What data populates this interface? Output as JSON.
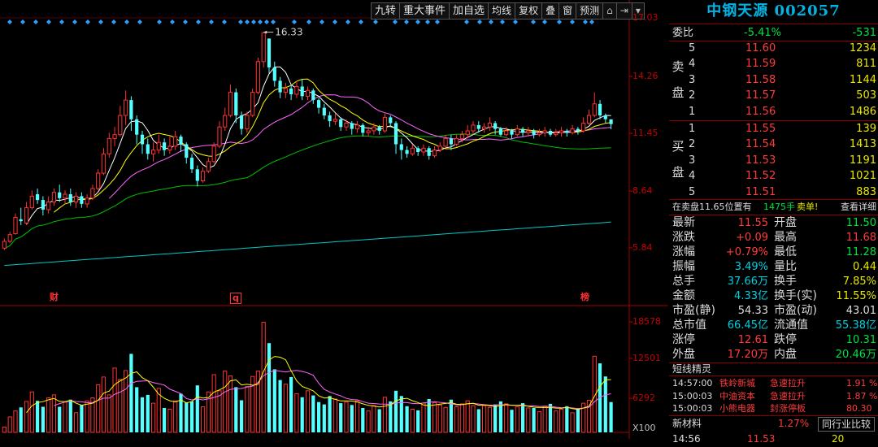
{
  "toolbar": [
    {
      "name": "jiuzhuan-button",
      "label": "九转"
    },
    {
      "name": "major-events-button",
      "label": "重大事件"
    },
    {
      "name": "add-watchlist-button",
      "label": "加自选"
    },
    {
      "name": "ma-line-button",
      "label": "均线"
    },
    {
      "name": "adjust-button",
      "label": "复权"
    },
    {
      "name": "overlay-button",
      "label": "叠"
    },
    {
      "name": "window-button",
      "label": "窗"
    },
    {
      "name": "forecast-button",
      "label": "预测"
    }
  ],
  "toolbar_icons": {
    "lock": "lock-icon",
    "skip": "skip-end-icon",
    "menu": "dropdown-icon"
  },
  "chart_data": {
    "type": "candlestick",
    "price_axis": {
      "ticks": [
        "17.03",
        "14.26",
        "11.45",
        "8.64",
        "5.84"
      ],
      "ylim": [
        3.0,
        17.03
      ]
    },
    "high_annotation": "16.33",
    "markers": [
      {
        "label": "财",
        "color": "#ff3030"
      },
      {
        "label": "q",
        "color": "#ff3030"
      },
      {
        "label": "榜",
        "color": "#ff3030"
      }
    ],
    "volume_axis": {
      "ticks": [
        "18578",
        "12501",
        "6292"
      ],
      "unit": "X100",
      "ylim": [
        0,
        18578
      ]
    },
    "colors": {
      "up": "#ff3232",
      "down": "#54ffff",
      "ma5": "#ffffff",
      "ma10": "#ffff00",
      "ma20": "#ff66ff",
      "ma60": "#00c000",
      "ma250": "#00c8c8",
      "vol_ma5": "#ffff00",
      "vol_ma10": "#ff66ff"
    },
    "candles": [
      [
        5.1,
        5.45,
        5.6,
        5.0
      ],
      [
        5.45,
        5.8,
        5.95,
        5.35
      ],
      [
        5.85,
        6.7,
        6.9,
        5.8
      ],
      [
        6.6,
        6.5,
        7.2,
        6.3
      ],
      [
        6.4,
        7.2,
        7.5,
        6.3
      ],
      [
        7.2,
        7.8,
        8.1,
        7.1
      ],
      [
        7.9,
        7.6,
        8.2,
        7.4
      ],
      [
        7.6,
        7.1,
        7.8,
        6.8
      ],
      [
        7.1,
        7.5,
        7.8,
        6.9
      ],
      [
        7.5,
        8.0,
        8.2,
        7.3
      ],
      [
        8.0,
        7.7,
        8.4,
        7.5
      ],
      [
        7.7,
        7.9,
        8.1,
        7.4
      ],
      [
        7.9,
        7.5,
        8.2,
        7.3
      ],
      [
        7.5,
        7.8,
        8.0,
        7.2
      ],
      [
        7.8,
        7.4,
        8.0,
        7.2
      ],
      [
        7.4,
        7.7,
        7.9,
        7.2
      ],
      [
        7.7,
        8.2,
        8.4,
        7.6
      ],
      [
        8.2,
        9.0,
        9.2,
        8.1
      ],
      [
        9.0,
        10.0,
        10.3,
        8.9
      ],
      [
        10.0,
        10.8,
        11.1,
        9.8
      ],
      [
        10.8,
        11.0,
        11.4,
        10.4
      ],
      [
        11.0,
        12.0,
        12.5,
        10.9
      ],
      [
        12.0,
        12.8,
        13.3,
        11.5
      ],
      [
        12.8,
        11.8,
        13.0,
        11.2
      ],
      [
        11.8,
        11.0,
        12.0,
        10.5
      ],
      [
        11.0,
        10.5,
        11.2,
        10.0
      ],
      [
        10.5,
        10.0,
        10.8,
        9.7
      ],
      [
        10.0,
        10.2,
        10.6,
        9.6
      ],
      [
        10.2,
        10.6,
        11.0,
        10.0
      ],
      [
        10.6,
        10.2,
        10.8,
        9.9
      ],
      [
        10.2,
        10.4,
        10.9,
        10.0
      ],
      [
        10.4,
        10.9,
        11.2,
        10.2
      ],
      [
        10.9,
        10.5,
        11.0,
        10.1
      ],
      [
        10.5,
        9.8,
        10.6,
        9.5
      ],
      [
        9.8,
        9.2,
        10.0,
        9.0
      ],
      [
        9.2,
        8.6,
        9.4,
        8.3
      ],
      [
        8.6,
        9.1,
        9.3,
        8.5
      ],
      [
        9.1,
        9.6,
        9.8,
        9.0
      ],
      [
        9.6,
        10.4,
        10.6,
        9.5
      ],
      [
        10.4,
        11.4,
        11.7,
        10.3
      ],
      [
        11.4,
        12.0,
        12.4,
        11.2
      ],
      [
        12.0,
        13.2,
        13.6,
        11.9
      ],
      [
        13.2,
        12.0,
        13.4,
        11.6
      ],
      [
        12.0,
        11.3,
        12.2,
        11.0
      ],
      [
        11.3,
        12.0,
        12.2,
        11.1
      ],
      [
        12.0,
        13.2,
        13.4,
        11.9
      ],
      [
        13.2,
        14.8,
        15.0,
        13.1
      ],
      [
        14.8,
        16.3,
        16.33,
        14.5
      ],
      [
        16.0,
        14.5,
        16.0,
        14.2
      ],
      [
        14.5,
        13.8,
        14.8,
        13.5
      ],
      [
        13.8,
        13.2,
        14.0,
        12.9
      ],
      [
        13.2,
        13.4,
        13.7,
        12.9
      ],
      [
        13.4,
        13.1,
        13.6,
        12.8
      ],
      [
        13.1,
        13.5,
        13.8,
        12.9
      ],
      [
        13.5,
        13.0,
        13.9,
        12.8
      ],
      [
        13.0,
        13.3,
        13.5,
        12.8
      ],
      [
        13.3,
        12.8,
        13.4,
        12.6
      ],
      [
        12.8,
        12.4,
        12.9,
        12.1
      ],
      [
        12.4,
        12.0,
        12.6,
        11.8
      ],
      [
        12.0,
        11.7,
        12.2,
        11.4
      ],
      [
        11.7,
        11.8,
        12.1,
        11.5
      ],
      [
        11.8,
        11.4,
        11.9,
        11.2
      ],
      [
        11.4,
        11.6,
        11.8,
        11.2
      ],
      [
        11.6,
        11.3,
        11.7,
        11.0
      ],
      [
        11.3,
        11.5,
        11.7,
        11.1
      ],
      [
        11.5,
        11.1,
        11.6,
        10.9
      ],
      [
        11.1,
        11.2,
        11.4,
        10.9
      ],
      [
        11.2,
        11.4,
        11.6,
        11.0
      ],
      [
        11.4,
        11.2,
        11.5,
        11.0
      ],
      [
        11.2,
        11.9,
        12.1,
        11.1
      ],
      [
        11.9,
        11.6,
        12.0,
        11.4
      ],
      [
        11.6,
        10.5,
        11.7,
        10.0
      ],
      [
        10.5,
        10.2,
        10.8,
        9.7
      ],
      [
        10.2,
        10.0,
        10.4,
        9.8
      ],
      [
        10.0,
        10.3,
        10.5,
        9.9
      ],
      [
        10.3,
        10.1,
        10.4,
        9.9
      ],
      [
        10.1,
        10.3,
        10.5,
        9.9
      ],
      [
        10.3,
        9.9,
        10.4,
        9.7
      ],
      [
        9.9,
        10.2,
        10.4,
        9.8
      ],
      [
        10.2,
        10.4,
        10.6,
        10.1
      ],
      [
        10.4,
        10.8,
        11.0,
        10.3
      ],
      [
        10.8,
        10.5,
        11.0,
        10.2
      ],
      [
        10.5,
        10.8,
        11.0,
        10.4
      ],
      [
        10.8,
        11.0,
        11.2,
        10.6
      ],
      [
        11.0,
        11.2,
        11.5,
        10.8
      ],
      [
        11.2,
        11.5,
        11.7,
        11.0
      ],
      [
        11.5,
        11.3,
        11.7,
        11.1
      ],
      [
        11.3,
        11.4,
        11.6,
        11.1
      ],
      [
        11.4,
        11.6,
        11.9,
        11.2
      ],
      [
        11.6,
        11.3,
        11.7,
        11.0
      ],
      [
        11.3,
        11.0,
        11.4,
        10.9
      ],
      [
        11.0,
        11.2,
        11.4,
        10.9
      ],
      [
        11.2,
        11.0,
        11.3,
        10.8
      ],
      [
        11.0,
        11.3,
        11.5,
        10.9
      ],
      [
        11.3,
        11.1,
        11.4,
        10.9
      ],
      [
        11.1,
        11.2,
        11.4,
        10.9
      ],
      [
        11.2,
        11.0,
        11.3,
        10.8
      ],
      [
        11.0,
        11.1,
        11.3,
        10.9
      ],
      [
        11.1,
        11.2,
        11.4,
        10.9
      ],
      [
        11.2,
        11.0,
        11.3,
        10.9
      ],
      [
        11.0,
        11.1,
        11.3,
        10.9
      ],
      [
        11.1,
        11.2,
        11.4,
        10.9
      ],
      [
        11.2,
        11.1,
        11.3,
        10.9
      ],
      [
        11.1,
        11.3,
        11.5,
        11.0
      ],
      [
        11.3,
        11.2,
        11.4,
        11.0
      ],
      [
        11.2,
        11.6,
        11.9,
        11.1
      ],
      [
        11.6,
        12.0,
        12.3,
        11.5
      ],
      [
        12.0,
        12.6,
        13.2,
        11.9
      ],
      [
        12.6,
        12.0,
        12.8,
        11.8
      ],
      [
        12.0,
        11.8,
        12.1,
        11.6
      ],
      [
        11.8,
        11.55,
        11.68,
        11.28
      ]
    ],
    "volumes": [
      900,
      2600,
      3600,
      4200,
      5200,
      6800,
      5300,
      4300,
      5800,
      6300,
      4300,
      5100,
      5500,
      3300,
      4600,
      5300,
      5800,
      8000,
      9300,
      6300,
      10800,
      8900,
      10400,
      13200,
      7600,
      5900,
      6300,
      4900,
      7400,
      4100,
      3900,
      5300,
      6500,
      5000,
      5200,
      7900,
      4300,
      6800,
      9700,
      7000,
      10300,
      9500,
      7600,
      5400,
      7700,
      9400,
      10300,
      18500,
      15000,
      10600,
      8800,
      8100,
      9300,
      6500,
      5900,
      7000,
      6200,
      5100,
      4700,
      6100,
      5600,
      4900,
      5100,
      4600,
      5300,
      4100,
      3600,
      4500,
      3900,
      5900,
      5200,
      7000,
      6100,
      4400,
      3900,
      3700,
      4900,
      5600,
      5000,
      4600,
      4200,
      5500,
      4300,
      4800,
      5300,
      4500,
      3900,
      4500,
      4200,
      4700,
      5200,
      4800,
      3800,
      4300,
      4900,
      4100,
      4100,
      3500,
      4400,
      4800,
      3600,
      3900,
      4400,
      3300,
      4000,
      4900,
      5400,
      12800,
      11600,
      9400,
      5100
    ]
  },
  "quote": {
    "title": "中钢天源 002057",
    "webi": {
      "label": "委比",
      "pct": "-5.41%",
      "diff": "-531"
    },
    "sell_side_label": [
      "卖",
      "盘"
    ],
    "buy_side_label": [
      "买",
      "盘"
    ],
    "sell": [
      {
        "lvl": "5",
        "price": "11.60",
        "vol": "1234"
      },
      {
        "lvl": "4",
        "price": "11.59",
        "vol": "811"
      },
      {
        "lvl": "3",
        "price": "11.58",
        "vol": "1144"
      },
      {
        "lvl": "2",
        "price": "11.57",
        "vol": "503"
      },
      {
        "lvl": "1",
        "price": "11.56",
        "vol": "1486"
      }
    ],
    "buy": [
      {
        "lvl": "1",
        "price": "11.55",
        "vol": "139"
      },
      {
        "lvl": "2",
        "price": "11.54",
        "vol": "1413"
      },
      {
        "lvl": "3",
        "price": "11.53",
        "vol": "1191"
      },
      {
        "lvl": "4",
        "price": "11.52",
        "vol": "1021"
      },
      {
        "lvl": "5",
        "price": "11.51",
        "vol": "883"
      }
    ],
    "alert": {
      "text": "在卖盘11.65位置有",
      "qty": "1475手",
      "kind": "卖单!",
      "link": "查看详细"
    },
    "stats": [
      {
        "l1": "最新",
        "v1": "11.55",
        "c1": "red",
        "l2": "开盘",
        "v2": "11.50",
        "c2": "green"
      },
      {
        "l1": "涨跌",
        "v1": "+0.09",
        "c1": "red",
        "l2": "最高",
        "v2": "11.68",
        "c2": "red"
      },
      {
        "l1": "涨幅",
        "v1": "+0.79%",
        "c1": "red",
        "l2": "最低",
        "v2": "11.28",
        "c2": "green"
      },
      {
        "l1": "振幅",
        "v1": "3.49%",
        "c1": "cyan",
        "l2": "量比",
        "v2": "0.44",
        "c2": "yellow"
      },
      {
        "l1": "总手",
        "v1": "37.66万",
        "c1": "cyan",
        "l2": "换手",
        "v2": "7.85%",
        "c2": "yellow"
      },
      {
        "l1": "金额",
        "v1": "4.33亿",
        "c1": "cyan",
        "l2": "换手(实)",
        "v2": "11.55%",
        "c2": "yellow"
      },
      {
        "l1": "市盈(静)",
        "v1": "54.33",
        "c1": "white",
        "l2": "市盈(动)",
        "v2": "43.01",
        "c2": "white"
      },
      {
        "l1": "总市值",
        "v1": "66.45亿",
        "c1": "cyan",
        "l2": "流通值",
        "v2": "55.38亿",
        "c2": "cyan"
      },
      {
        "l1": "涨停",
        "v1": "12.61",
        "c1": "red",
        "l2": "跌停",
        "v2": "10.31",
        "c2": "green"
      },
      {
        "l1": "外盘",
        "v1": "17.20万",
        "c1": "red",
        "l2": "内盘",
        "v2": "20.46万",
        "c2": "green"
      }
    ],
    "short_title": "短线精灵",
    "short_list": [
      {
        "time": "14:57:00",
        "name": "铁岭新城",
        "event": "急速拉升",
        "pct": "1.91 %"
      },
      {
        "time": "15:00:03",
        "name": "中油资本",
        "event": "急速拉升",
        "pct": "1.87 %"
      },
      {
        "time": "15:00:03",
        "name": "小熊电器",
        "event": "封涨停板",
        "pct": "80.30"
      }
    ],
    "sector": {
      "name": "新材料",
      "pct": "1.27%",
      "compare": "同行业比较"
    },
    "bottom": {
      "time": "14:56",
      "price": "11.53",
      "vol": "20"
    }
  }
}
